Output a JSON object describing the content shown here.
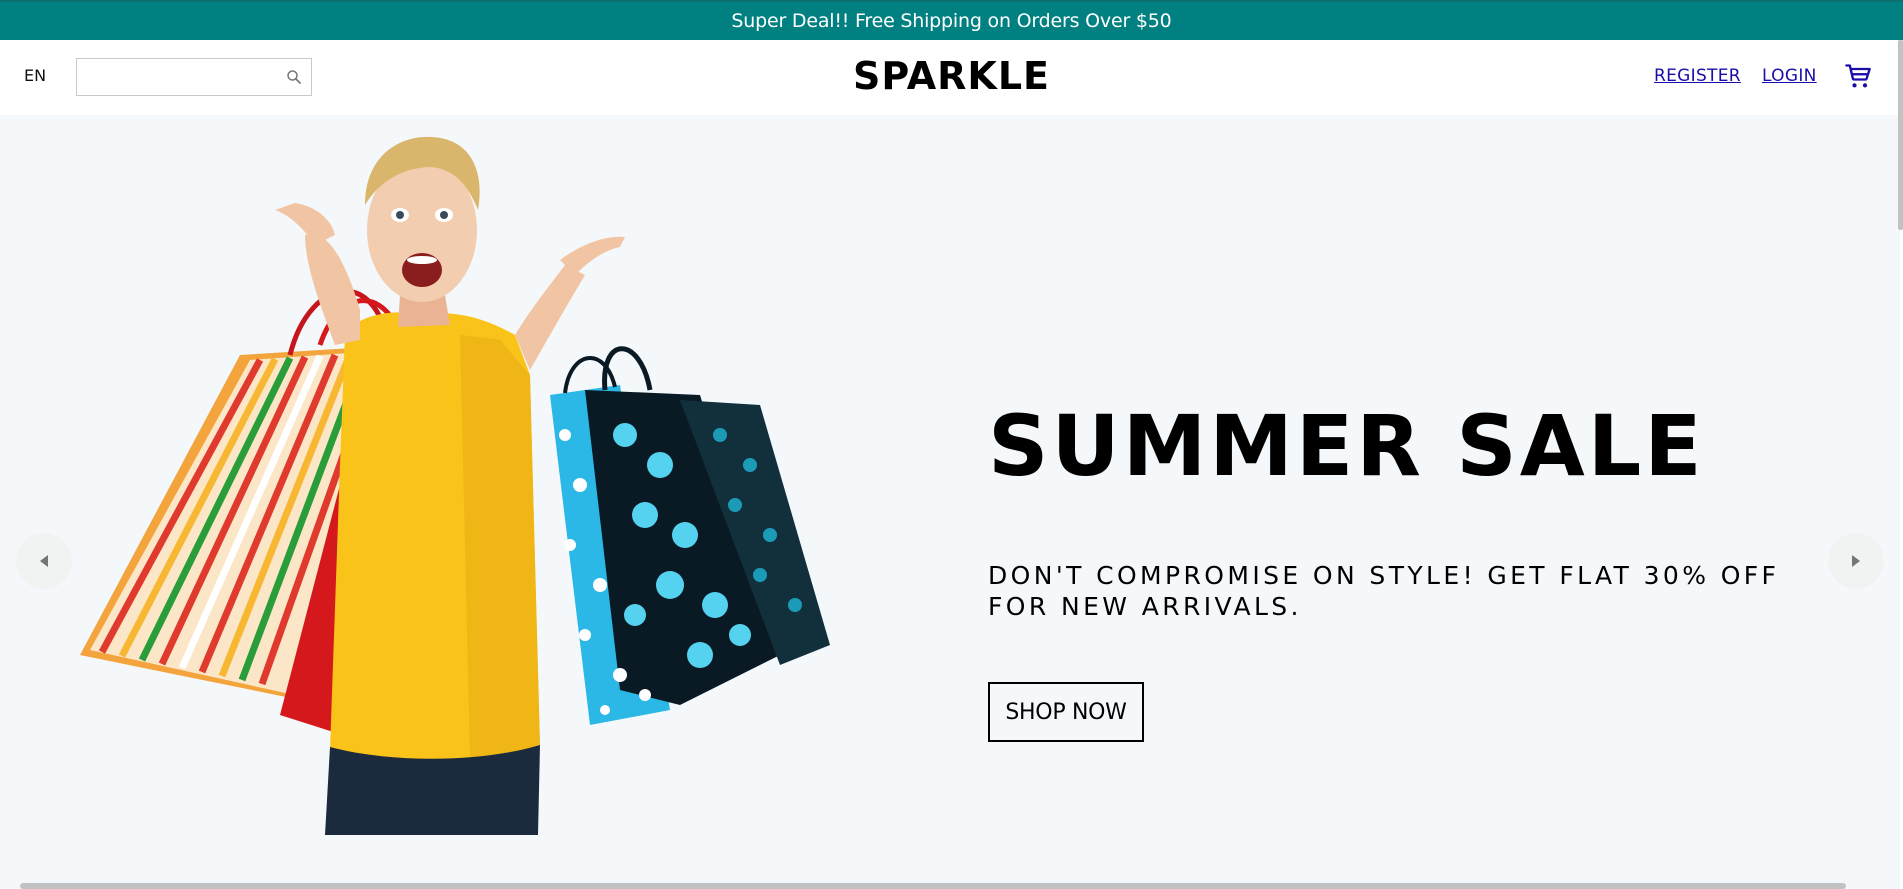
{
  "announcement": {
    "text": "Super Deal!! Free Shipping on Orders Over $50",
    "background": "#008080"
  },
  "navbar": {
    "language": "EN",
    "search": {
      "value": "",
      "placeholder": "",
      "icon": "search-icon"
    },
    "logo": "SPARKLE",
    "links": {
      "register": "REGISTER",
      "login": "LOGIN"
    },
    "cart_icon": "shopping-cart-icon",
    "link_color": "#1a0dab"
  },
  "slider": {
    "background": "#f4f8fa",
    "slide": {
      "title": "SUMMER SALE",
      "description": "DON'T COMPROMISE ON STYLE! GET FLAT 30% OFF FOR NEW ARRIVALS.",
      "button_label": "SHOP NOW",
      "image": "woman-with-shopping-bags"
    },
    "prev_icon": "arrow-left-icon",
    "next_icon": "arrow-right-icon"
  }
}
